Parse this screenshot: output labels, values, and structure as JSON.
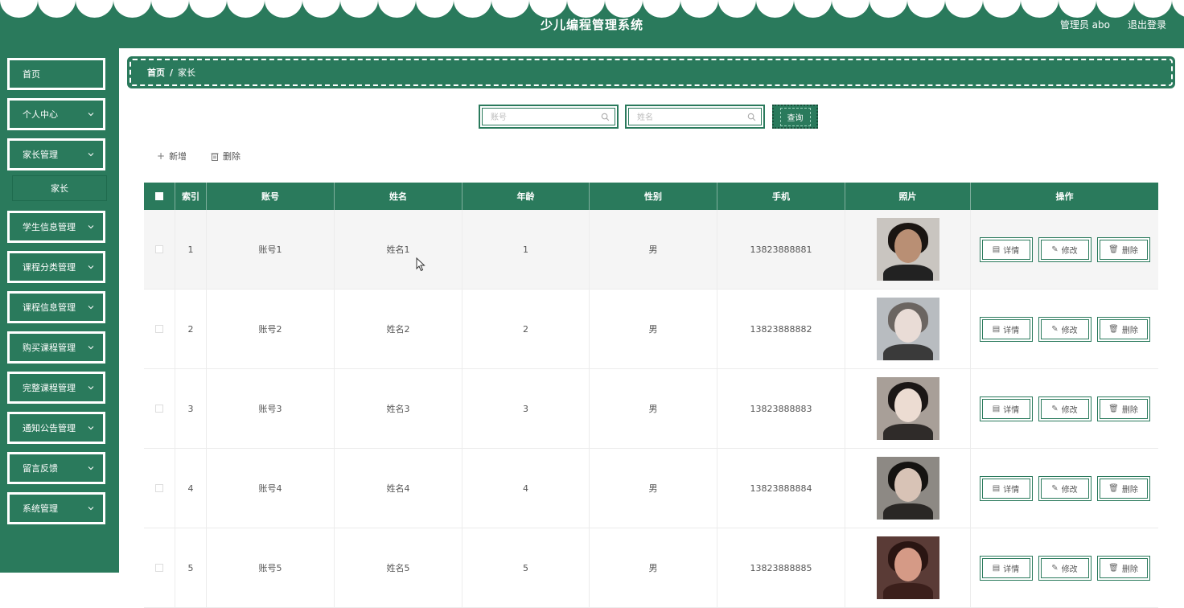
{
  "header": {
    "title": "少儿编程管理系统",
    "user": "管理员 abo",
    "logout": "退出登录"
  },
  "sidebar": {
    "items": [
      {
        "label": "首页",
        "has_chevron": false
      },
      {
        "label": "个人中心",
        "has_chevron": true
      },
      {
        "label": "家长管理",
        "has_chevron": true
      },
      {
        "label": "学生信息管理",
        "has_chevron": true
      },
      {
        "label": "课程分类管理",
        "has_chevron": true
      },
      {
        "label": "课程信息管理",
        "has_chevron": true
      },
      {
        "label": "购买课程管理",
        "has_chevron": true
      },
      {
        "label": "完整课程管理",
        "has_chevron": true
      },
      {
        "label": "通知公告管理",
        "has_chevron": true
      },
      {
        "label": "留言反馈",
        "has_chevron": true
      },
      {
        "label": "系统管理",
        "has_chevron": true
      }
    ],
    "sub_item": "家长"
  },
  "breadcrumb": {
    "home": "首页",
    "separator": "/",
    "current": "家长"
  },
  "search": {
    "account_placeholder": "账号",
    "name_placeholder": "姓名",
    "query_label": "查询"
  },
  "toolbar": {
    "add_label": "新增",
    "delete_label": "删除"
  },
  "table": {
    "columns": [
      "索引",
      "账号",
      "姓名",
      "年龄",
      "性别",
      "手机",
      "照片",
      "操作"
    ],
    "rows": [
      {
        "index": "1",
        "account": "账号1",
        "name": "姓名1",
        "age": "1",
        "sex": "男",
        "phone": "13823888881"
      },
      {
        "index": "2",
        "account": "账号2",
        "name": "姓名2",
        "age": "2",
        "sex": "男",
        "phone": "13823888882"
      },
      {
        "index": "3",
        "account": "账号3",
        "name": "姓名3",
        "age": "3",
        "sex": "男",
        "phone": "13823888883"
      },
      {
        "index": "4",
        "account": "账号4",
        "name": "姓名4",
        "age": "4",
        "sex": "男",
        "phone": "13823888884"
      },
      {
        "index": "5",
        "account": "账号5",
        "name": "姓名5",
        "age": "5",
        "sex": "男",
        "phone": "13823888885"
      }
    ],
    "actions": {
      "detail": "详情",
      "edit": "修改",
      "delete": "删除"
    }
  },
  "colors": {
    "primary": "#2a7a5c",
    "white": "#ffffff"
  }
}
